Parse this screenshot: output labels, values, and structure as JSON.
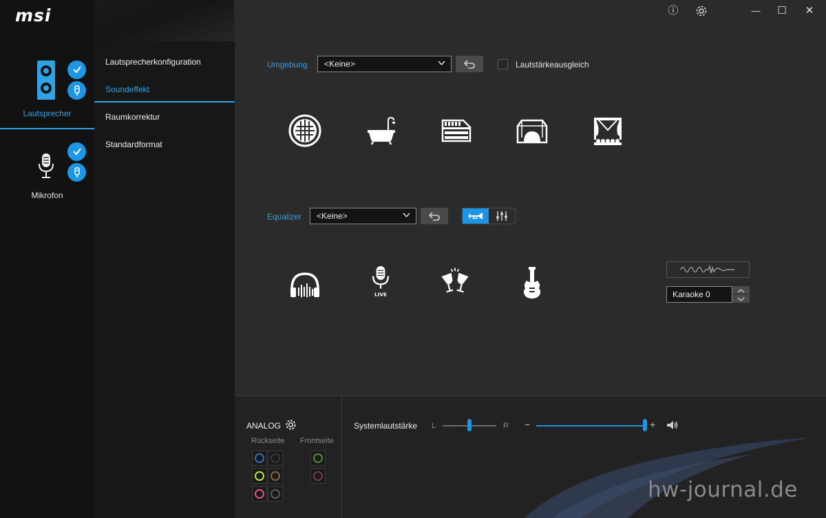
{
  "app": {
    "logo": "msi"
  },
  "window_controls": {
    "info": "ⓘ",
    "minimize": "—",
    "maximize": "☐",
    "close": "✕"
  },
  "devices": [
    {
      "label": "Lautsprecher",
      "active": true
    },
    {
      "label": "Mikrofon",
      "active": false
    }
  ],
  "nav": {
    "items": [
      {
        "label": "Lautsprecherkonfiguration",
        "active": false
      },
      {
        "label": "Soundeffekt",
        "active": true
      },
      {
        "label": "Raumkorrektur",
        "active": false
      },
      {
        "label": "Standardformat",
        "active": false
      }
    ]
  },
  "environment": {
    "label": "Umgebung",
    "selected": "<Keine>",
    "loudness_label": "Lautstärkeausgleich",
    "loudness_checked": false,
    "presets": [
      "sphere-icon",
      "bathroom-icon",
      "hall-icon",
      "room-icon",
      "stage-icon"
    ]
  },
  "equalizer": {
    "label": "Equalizer",
    "selected": "<Keine>",
    "presets": [
      "headphones-icon",
      "live-mic-icon",
      "party-icon",
      "guitar-icon"
    ],
    "live_text": "LIVE",
    "karaoke_value": "Karaoke 0"
  },
  "bottom": {
    "analog_title": "ANALOG",
    "back_label": "Rückseite",
    "front_label": "Frontseite",
    "system_volume_label": "Systemlautstärke",
    "balance_left": "L",
    "balance_right": "R",
    "minus": "−",
    "plus": "+",
    "watermark": "hw-journal.de",
    "balance_fraction": 0.5,
    "volume_fraction": 1.0
  },
  "colors": {
    "accent": "#2fa3e6",
    "jacks_back": [
      "#2f6fb8",
      "#3a3a3a",
      "#b8e84a",
      "#8a6440",
      "#e6508a",
      "#5a5a5a"
    ],
    "jacks_front": [
      "#5a8a3a",
      "#7a3a4a"
    ]
  }
}
